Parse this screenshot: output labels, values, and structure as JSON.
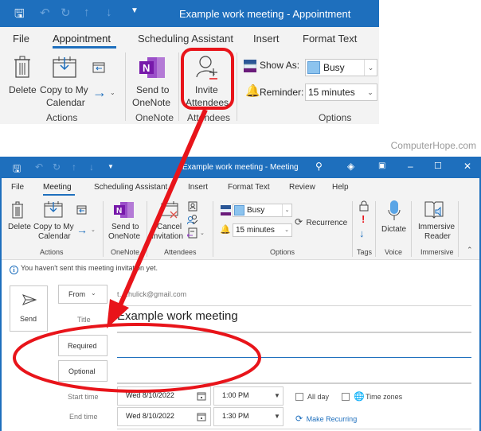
{
  "top_window": {
    "title": "Example work meeting  -  Appointment",
    "tabs": [
      {
        "label": "File",
        "active": false
      },
      {
        "label": "Appointment",
        "active": true
      },
      {
        "label": "Scheduling Assistant",
        "active": false
      },
      {
        "label": "Insert",
        "active": false
      },
      {
        "label": "Format Text",
        "active": false
      }
    ],
    "ribbon": {
      "delete_label": "Delete",
      "copy_line1": "Copy to My",
      "copy_line2": "Calendar",
      "actions_group": "Actions",
      "send_onenote_line1": "Send to",
      "send_onenote_line2": "OneNote",
      "onenote_group": "OneNote",
      "invite_line1": "Invite",
      "invite_line2": "Attendees",
      "attendees_group": "Attendees",
      "show_as_label": "Show As:",
      "show_as_value": "Busy",
      "reminder_label": "Reminder:",
      "reminder_value": "15 minutes",
      "options_group": "Options"
    }
  },
  "watermark": "ComputerHope.com",
  "bottom_window": {
    "title": "Example work meeting  -  Meeting",
    "tabs": [
      {
        "label": "File",
        "active": false
      },
      {
        "label": "Meeting",
        "active": true
      },
      {
        "label": "Scheduling Assistant",
        "active": false
      },
      {
        "label": "Insert",
        "active": false
      },
      {
        "label": "Format Text",
        "active": false
      },
      {
        "label": "Review",
        "active": false
      },
      {
        "label": "Help",
        "active": false
      }
    ],
    "ribbon": {
      "delete_label": "Delete",
      "copy_line1": "Copy to My",
      "copy_line2": "Calendar",
      "actions_group": "Actions",
      "send_onenote_line1": "Send to",
      "send_onenote_line2": "OneNote",
      "onenote_group": "OneNote",
      "cancel_line1": "Cancel",
      "cancel_line2": "Invitation",
      "attendees_group": "Attendees",
      "show_as_value": "Busy",
      "reminder_value": "15 minutes",
      "recurrence_label": "Recurrence",
      "options_group": "Options",
      "tags_group": "Tags",
      "dictate_label": "Dictate",
      "voice_group": "Voice",
      "immersive_line1": "Immersive",
      "immersive_line2": "Reader",
      "immersive_group": "Immersive"
    },
    "info_message": "You haven't sent this meeting invitation yet.",
    "form": {
      "send_label": "Send",
      "from_label": "From",
      "from_value": "t….hulick@gmail.com",
      "title_label": "Title",
      "title_value": "Example work meeting",
      "required_label": "Required",
      "required_value": "",
      "optional_label": "Optional",
      "optional_value": "",
      "start_time_label": "Start time",
      "start_date": "Wed 8/10/2022",
      "start_time": "1:00 PM",
      "all_day_label": "All day",
      "all_day_checked": false,
      "time_zones_label": "Time zones",
      "time_zones_checked": false,
      "end_time_label": "End time",
      "end_date": "Wed 8/10/2022",
      "end_time": "1:30 PM",
      "make_recurring_label": "Make Recurring"
    }
  },
  "annotation": {
    "highlight_color": "#e8141a"
  },
  "colors": {
    "titlebar": "#1e6fbd",
    "ribbon_bg": "#f3f3f3",
    "onenote_purple": "#7719aa",
    "busy_swatch": "#8cc3ee"
  }
}
